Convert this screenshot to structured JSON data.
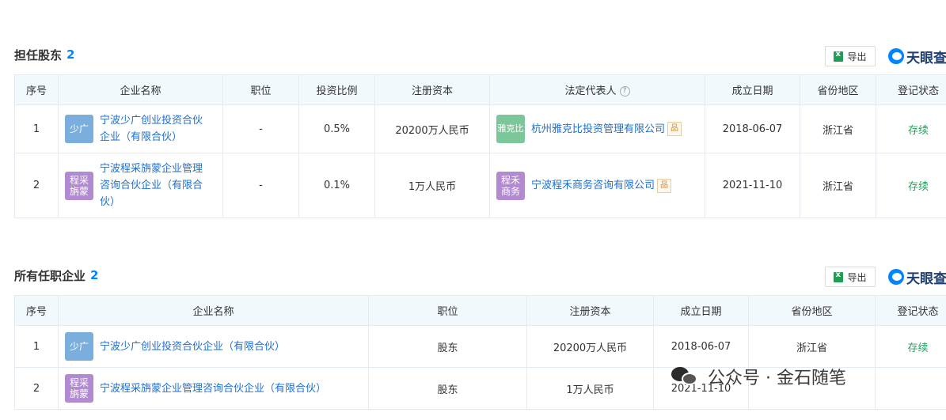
{
  "brand": {
    "text": "天眼查"
  },
  "export_label": "导出",
  "shareholder": {
    "title": "担任股东",
    "count": "2",
    "headers": [
      "序号",
      "企业名称",
      "职位",
      "投资比例",
      "注册资本",
      "法定代表人",
      "成立日期",
      "省份地区",
      "登记状态"
    ],
    "rows": [
      {
        "index": "1",
        "logo_text": "少广",
        "company_line1": "宁波少广创业投资合伙",
        "company_line2": "企业（有限合伙）",
        "company_line3": "",
        "position": "-",
        "ratio": "0.5%",
        "capital": "20200万人民币",
        "rep_logo_line1": "雅克比",
        "rep_logo_line2": "",
        "rep_name": "杭州雅克比投资管理有限公司",
        "date": "2018-06-07",
        "region": "浙江省",
        "status": "存续"
      },
      {
        "index": "2",
        "logo_text": "程采旃蒙",
        "company_line1": "宁波程采旃蒙企业管理",
        "company_line2": "咨询合伙企业（有限合",
        "company_line3": "伙）",
        "position": "-",
        "ratio": "0.1%",
        "capital": "1万人民币",
        "rep_logo_line1": "程禾",
        "rep_logo_line2": "商务",
        "rep_name": "宁波程禾商务咨询有限公司",
        "date": "2021-11-10",
        "region": "浙江省",
        "status": "存续"
      }
    ]
  },
  "positions": {
    "title": "所有任职企业",
    "count": "2",
    "headers": [
      "序号",
      "企业名称",
      "职位",
      "注册资本",
      "成立日期",
      "省份地区",
      "登记状态"
    ],
    "rows": [
      {
        "index": "1",
        "logo_text": "少广",
        "company": "宁波少广创业投资合伙企业（有限合伙）",
        "position": "股东",
        "capital": "20200万人民币",
        "date": "2018-06-07",
        "region": "浙江省",
        "status": "存续"
      },
      {
        "index": "2",
        "logo_text": "程采旃蒙",
        "company": "宁波程采旃蒙企业管理咨询合伙企业（有限合伙）",
        "position": "股东",
        "capital": "1万人民币",
        "date": "2021-11-10",
        "region": "",
        "status": ""
      }
    ]
  },
  "watermark": {
    "text": "公众号 · 金石随笔"
  },
  "colors": {
    "link": "#1e6fd1",
    "count": "#0084ff",
    "status": "#22a05a",
    "header_bg": "#f2f9fc"
  }
}
